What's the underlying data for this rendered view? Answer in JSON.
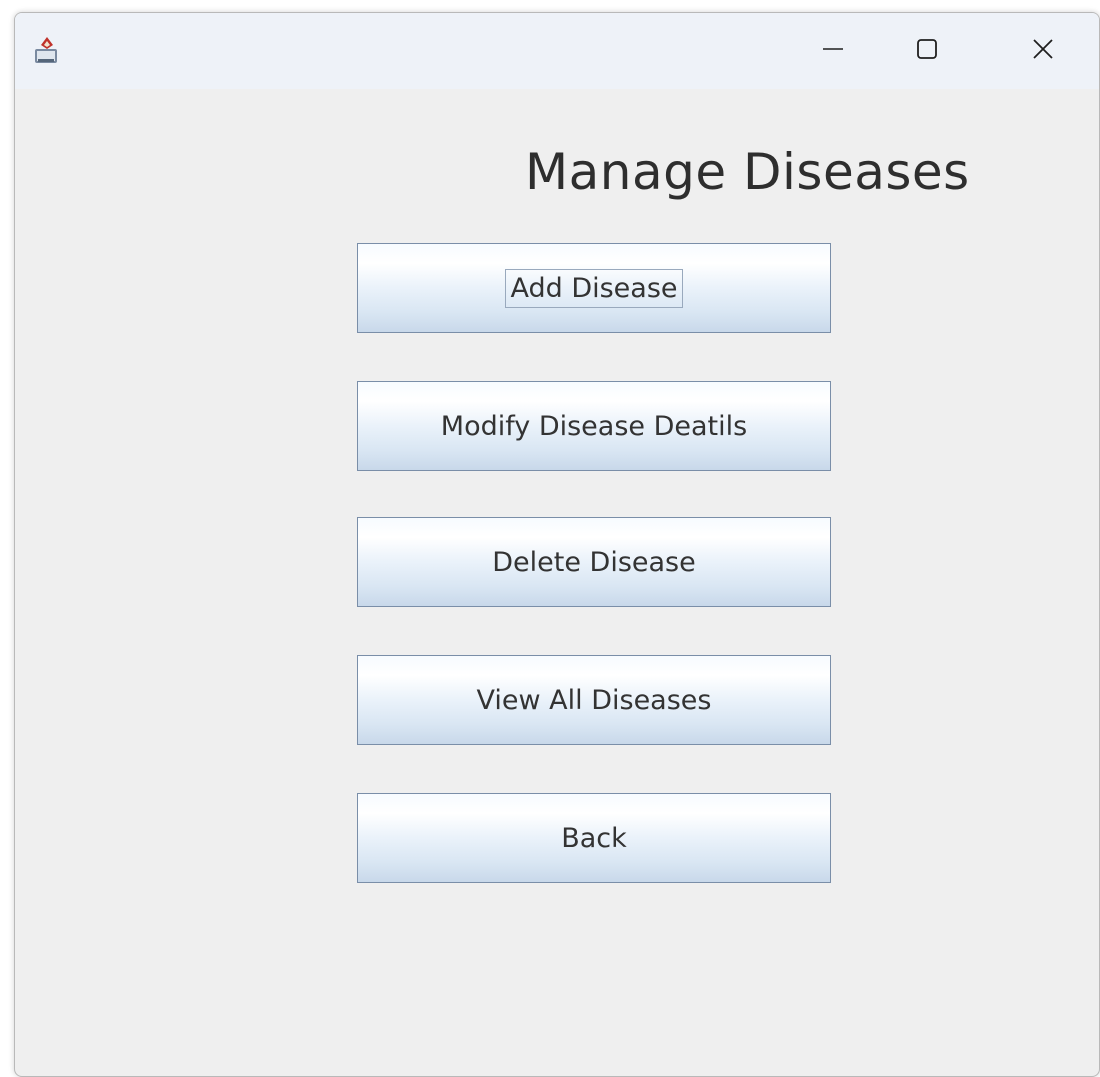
{
  "window": {
    "app_icon": "java-cup-icon",
    "controls": {
      "minimize_icon": "minimize-icon",
      "maximize_icon": "maximize-icon",
      "close_icon": "close-icon"
    }
  },
  "page": {
    "title": "Manage Diseases"
  },
  "buttons": {
    "add": "Add Disease",
    "modify": "Modify Disease Deatils",
    "delete": "Delete Disease",
    "view_all": "View All Diseases",
    "back": "Back"
  },
  "colors": {
    "window_bg": "#efefef",
    "titlebar_bg": "#eef2f8",
    "button_border": "#7a8ea8",
    "button_gradient_top": "#ffffff",
    "button_gradient_bottom": "#c8d8ea"
  }
}
